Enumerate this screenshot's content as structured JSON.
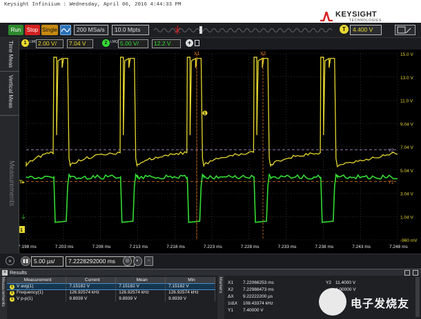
{
  "window": {
    "title": "Keysight Infiniium : Wednesday, April 06, 2016 4:44:33 PM"
  },
  "brand": {
    "name": "KEYSIGHT",
    "tagline": "TECHNOLOGIES"
  },
  "toolbar": {
    "run_label": "Run",
    "stop_label": "Stop",
    "single_label": "Single",
    "sample_rate": "200 MSa/s",
    "memory_depth": "10.0 Mpts",
    "trigger_badge": "T",
    "trigger_level": "4.400 V"
  },
  "channels": {
    "ch1": {
      "number": "1",
      "hl": "LMQ",
      "scale": "2.00 V/",
      "offset": "7.04 V",
      "color": "#e8d830"
    },
    "ch2": {
      "number": "2",
      "hl": "LMQ",
      "scale": "5.00 V/",
      "offset": "12.2 V",
      "color": "#33dd33"
    },
    "add_label": "+"
  },
  "sidebar": {
    "tab_time_meas": "Time Meas",
    "tab_vertical_meas": "Vertical Meas",
    "tab_measurements": "Measurements"
  },
  "scope": {
    "marker_labels": {
      "x1": "X1",
      "x2": "X2",
      "y1": "Y1",
      "y2": "Y2"
    },
    "y_ticks": [
      "15.0 V",
      "13.0 V",
      "11.0 V",
      "9.04 V",
      "7.04 V",
      "5.04 V",
      "3.04 V",
      "1.04 V",
      "-960 mV"
    ],
    "x_ticks": [
      "7.198 ms",
      "7.203 ms",
      "7.208 ms",
      "7.213 ms",
      "7.218 ms",
      "7.223 ms",
      "7.228 ms",
      "7.233 ms",
      "7.238 ms",
      "7.243 ms",
      "7.248 ms"
    ],
    "trigger_marker": "T",
    "ch1_marker": "1",
    "ch2_marker": "2",
    "colors": {
      "ch1": "#e8d830",
      "ch2": "#33dd33",
      "cursor_x": "#e07a20",
      "cursor_y": "#b090d0",
      "grid": "#555555"
    }
  },
  "horizontal": {
    "scale": "5.00 µs/",
    "position": "7.2228292000 ms"
  },
  "results": {
    "title": "Results",
    "side_tab": "Measurements",
    "markers_tab": "Markers",
    "columns": [
      "Measurement",
      "Current",
      "Mean",
      "Min"
    ],
    "rows": [
      {
        "name": "V avg(1)",
        "current": "7.15182 V",
        "mean": "7.15182 V",
        "min": "7.15182 V"
      },
      {
        "name": "Frequency(1)",
        "current": "126.92574 kHz",
        "mean": "126.92574 kHz",
        "min": "126.92574 kHz"
      },
      {
        "name": "V p-p(1)",
        "current": "9.8939 V",
        "mean": "9.8939 V",
        "min": "9.8939 V"
      }
    ],
    "markers": [
      {
        "k": "X1",
        "v": "7.22066253 ms"
      },
      {
        "k": "X2",
        "v": "7.22988473 ms"
      },
      {
        "k": "ΔX",
        "v": "9.22222200 µs"
      },
      {
        "k": "1/ΔX",
        "v": "108.43374 kHz"
      },
      {
        "k": "Y1",
        "v": "7.40000 V"
      }
    ],
    "markers_y": [
      {
        "k": "Y2",
        "v": "11.4000 V"
      },
      {
        "k": "",
        "v": "4.00000 V"
      }
    ]
  },
  "watermark": {
    "text": "电子发烧友"
  }
}
